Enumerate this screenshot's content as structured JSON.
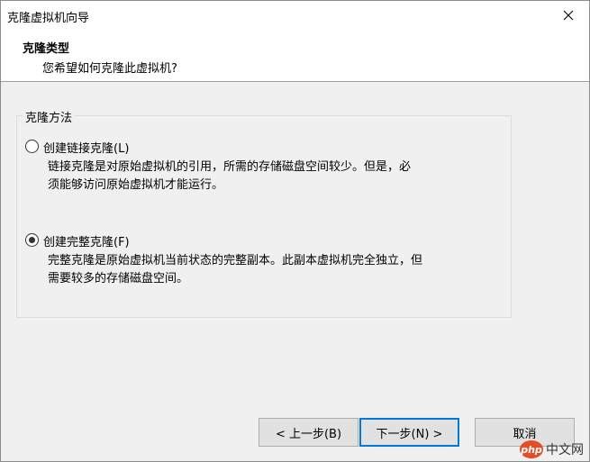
{
  "window": {
    "title": "克隆虚拟机向导"
  },
  "header": {
    "title": "克隆类型",
    "subtitle": "您希望如何克隆此虚拟机?"
  },
  "group": {
    "legend": "克隆方法",
    "options": [
      {
        "label": "创建链接克隆(L)",
        "desc_line1": "链接克隆是对原始虚拟机的引用，所需的存储磁盘空间较少。但是，必",
        "desc_line2": "须能够访问原始虚拟机才能运行。",
        "selected": false
      },
      {
        "label": "创建完整克隆(F)",
        "desc_line1": "完整克隆是原始虚拟机当前状态的完整副本。此副本虚拟机完全独立，但",
        "desc_line2": "需要较多的存储磁盘空间。",
        "selected": true
      }
    ]
  },
  "buttons": {
    "back": "< 上一步(B)",
    "next": "下一步(N) >",
    "cancel": "取消"
  },
  "watermark": {
    "logo": "php",
    "text": "中文网"
  }
}
